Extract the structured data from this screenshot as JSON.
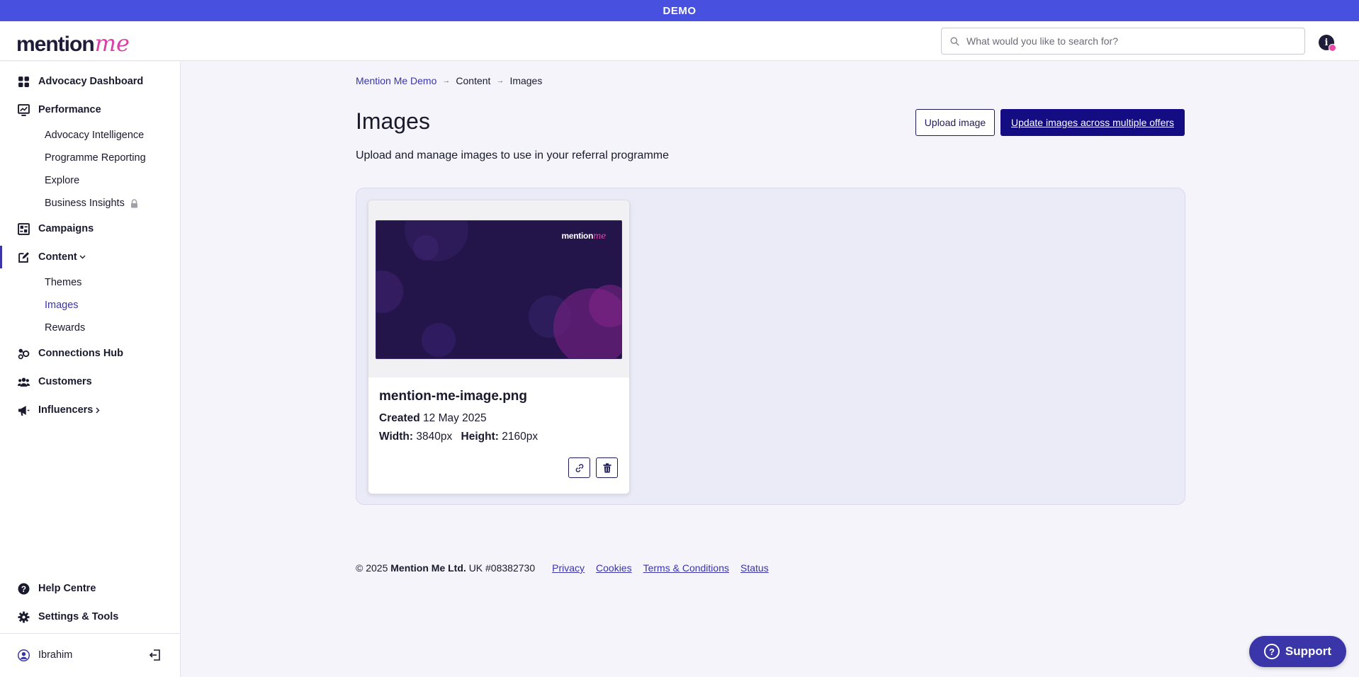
{
  "banner": {
    "label": "DEMO"
  },
  "header": {
    "logo_text": "mention",
    "logo_accent": "me",
    "search_placeholder": "What would you like to search for?",
    "info_label": "i"
  },
  "sidebar": {
    "items": [
      {
        "label": "Advocacy Dashboard",
        "icon": "dashboard-icon"
      },
      {
        "label": "Performance",
        "icon": "chart-icon"
      },
      {
        "label": "Advocacy Intelligence"
      },
      {
        "label": "Programme Reporting"
      },
      {
        "label": "Explore"
      },
      {
        "label": "Business Insights",
        "icon": "lock-icon"
      },
      {
        "label": "Campaigns",
        "icon": "campaign-icon"
      },
      {
        "label": "Content",
        "icon": "edit-icon"
      },
      {
        "label": "Themes"
      },
      {
        "label": "Images"
      },
      {
        "label": "Rewards"
      },
      {
        "label": "Connections Hub",
        "icon": "connections-icon"
      },
      {
        "label": "Customers",
        "icon": "users-icon"
      },
      {
        "label": "Influencers",
        "icon": "megaphone-icon"
      }
    ],
    "help": "Help Centre",
    "settings": "Settings & Tools",
    "user_name": "Ibrahim"
  },
  "breadcrumb": {
    "root": "Mention Me Demo",
    "section": "Content",
    "current": "Images"
  },
  "page": {
    "title": "Images",
    "subtitle": "Upload and manage images to use in your referral programme",
    "upload_button": "Upload image",
    "update_button": "Update images across multiple offers"
  },
  "images": [
    {
      "filename": "mention-me-image.png",
      "created_label": "Created",
      "created_value": "12 May 2025",
      "width_label": "Width:",
      "width_value": "3840px",
      "height_label": "Height:",
      "height_value": "2160px",
      "thumb_logo": "mention",
      "thumb_logo_accent": "me"
    }
  ],
  "footer": {
    "copyright_prefix": "© 2025",
    "company": "Mention Me Ltd.",
    "company_number": "UK #08382730",
    "links": [
      "Privacy",
      "Cookies",
      "Terms & Conditions",
      "Status"
    ]
  },
  "support": {
    "label": "Support",
    "icon_glyph": "?"
  },
  "colors": {
    "banner": "#4850e0",
    "primary": "#130c82",
    "accent": "#3a35a8",
    "brand_pink": "#d93fa7",
    "gallery_bg": "#ebebf8"
  }
}
